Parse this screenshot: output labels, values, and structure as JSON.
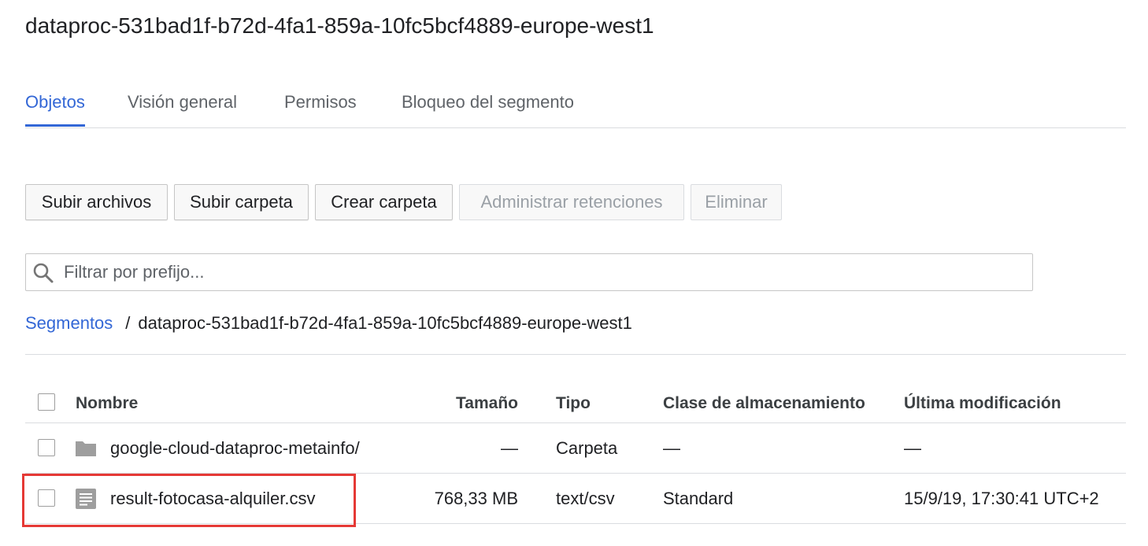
{
  "bucket": {
    "title": "dataproc-531bad1f-b72d-4fa1-859a-10fc5bcf4889-europe-west1"
  },
  "tabs": [
    {
      "label": "Objetos",
      "active": true
    },
    {
      "label": "Visión general",
      "active": false
    },
    {
      "label": "Permisos",
      "active": false
    },
    {
      "label": "Bloqueo del segmento",
      "active": false
    }
  ],
  "toolbar": {
    "upload_files": "Subir archivos",
    "upload_folder": "Subir carpeta",
    "create_folder": "Crear carpeta",
    "manage_holds": "Administrar retenciones",
    "delete": "Eliminar"
  },
  "filter": {
    "placeholder": "Filtrar por prefijo...",
    "icon": "search-icon"
  },
  "breadcrumb": {
    "root": "Segmentos",
    "separator": "/",
    "current": "dataproc-531bad1f-b72d-4fa1-859a-10fc5bcf4889-europe-west1"
  },
  "table": {
    "columns": {
      "name": "Nombre",
      "size": "Tamaño",
      "type": "Tipo",
      "storage_class": "Clase de almacenamiento",
      "modified": "Última modificación"
    },
    "rows": [
      {
        "icon": "folder-icon",
        "name": "google-cloud-dataproc-metainfo/",
        "size": "—",
        "type": "Carpeta",
        "storage_class": "—",
        "modified": "—"
      },
      {
        "icon": "file-icon",
        "name": "result-fotocasa-alquiler.csv",
        "size": "768,33 MB",
        "type": "text/csv",
        "storage_class": "Standard",
        "modified": "15/9/19, 17:30:41 UTC+2"
      }
    ]
  },
  "colors": {
    "accent": "#3367d6",
    "highlight": "#e53935",
    "icon_gray": "#9e9e9e",
    "divider": "#dadce0"
  }
}
